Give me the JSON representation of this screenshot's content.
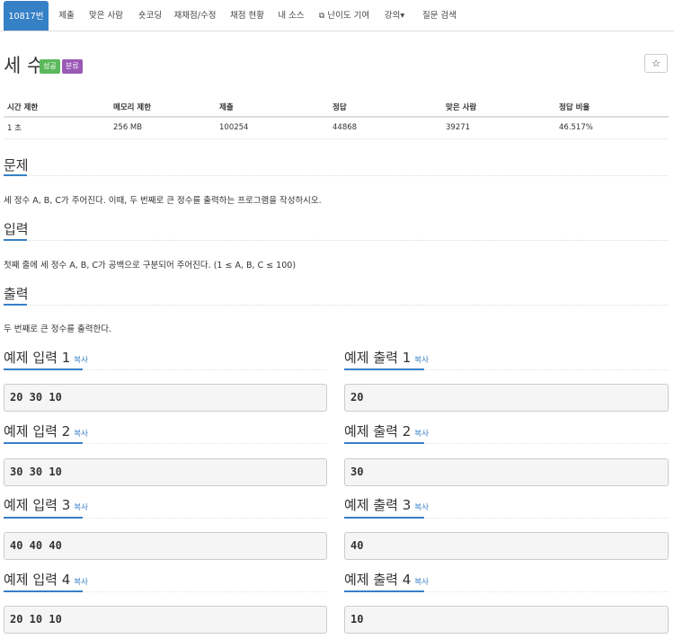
{
  "tabs": [
    {
      "label": "10817번",
      "active": true
    },
    {
      "label": "제출"
    },
    {
      "label": "맞은 사람"
    },
    {
      "label": "숏코딩"
    },
    {
      "label": "재채점/수정"
    },
    {
      "label": "채점 현황"
    },
    {
      "label": "내 소스"
    },
    {
      "label": "난이도 기여",
      "icon": "external-link-icon"
    },
    {
      "label": "강의▾"
    },
    {
      "label": "질문 검색"
    }
  ],
  "problem": {
    "title": "세 수",
    "badges": [
      {
        "label": "성공",
        "color": "#5cb85c"
      },
      {
        "label": "분류",
        "color": "#9b59b6"
      }
    ],
    "star": "☆"
  },
  "info_table": {
    "headers": [
      "시간 제한",
      "메모리 제한",
      "제출",
      "정답",
      "맞은 사람",
      "정답 비율"
    ],
    "row": [
      "1 초",
      "256 MB",
      "100254",
      "44868",
      "39271",
      "46.517%"
    ]
  },
  "sections": [
    {
      "title": "문제",
      "text": "세 정수 A, B, C가 주어진다. 이때, 두 번째로 큰 정수를 출력하는 프로그램을 작성하시오."
    },
    {
      "title": "입력",
      "text": "첫째 줄에 세 정수 A, B, C가 공백으로 구분되어 주어진다. (1 ≤ A, B, C ≤ 100)"
    },
    {
      "title": "출력",
      "text": "두 번째로 큰 정수를 출력한다."
    }
  ],
  "examples": [
    {
      "input_title": "예제 입력 1",
      "output_title": "예제 출력 1",
      "copy": "복사",
      "input": "20 30 10",
      "output": "20"
    },
    {
      "input_title": "예제 입력 2",
      "output_title": "예제 출력 2",
      "copy": "복사",
      "input": "30 30 10",
      "output": "30"
    },
    {
      "input_title": "예제 입력 3",
      "output_title": "예제 출력 3",
      "copy": "복사",
      "input": "40 40 40",
      "output": "40"
    },
    {
      "input_title": "예제 입력 4",
      "output_title": "예제 출력 4",
      "copy": "복사",
      "input": "20 10 10",
      "output": "10"
    }
  ],
  "colors": {
    "accent": "#3680c6",
    "success": "#5cb85c",
    "category": "#9b59b6"
  }
}
